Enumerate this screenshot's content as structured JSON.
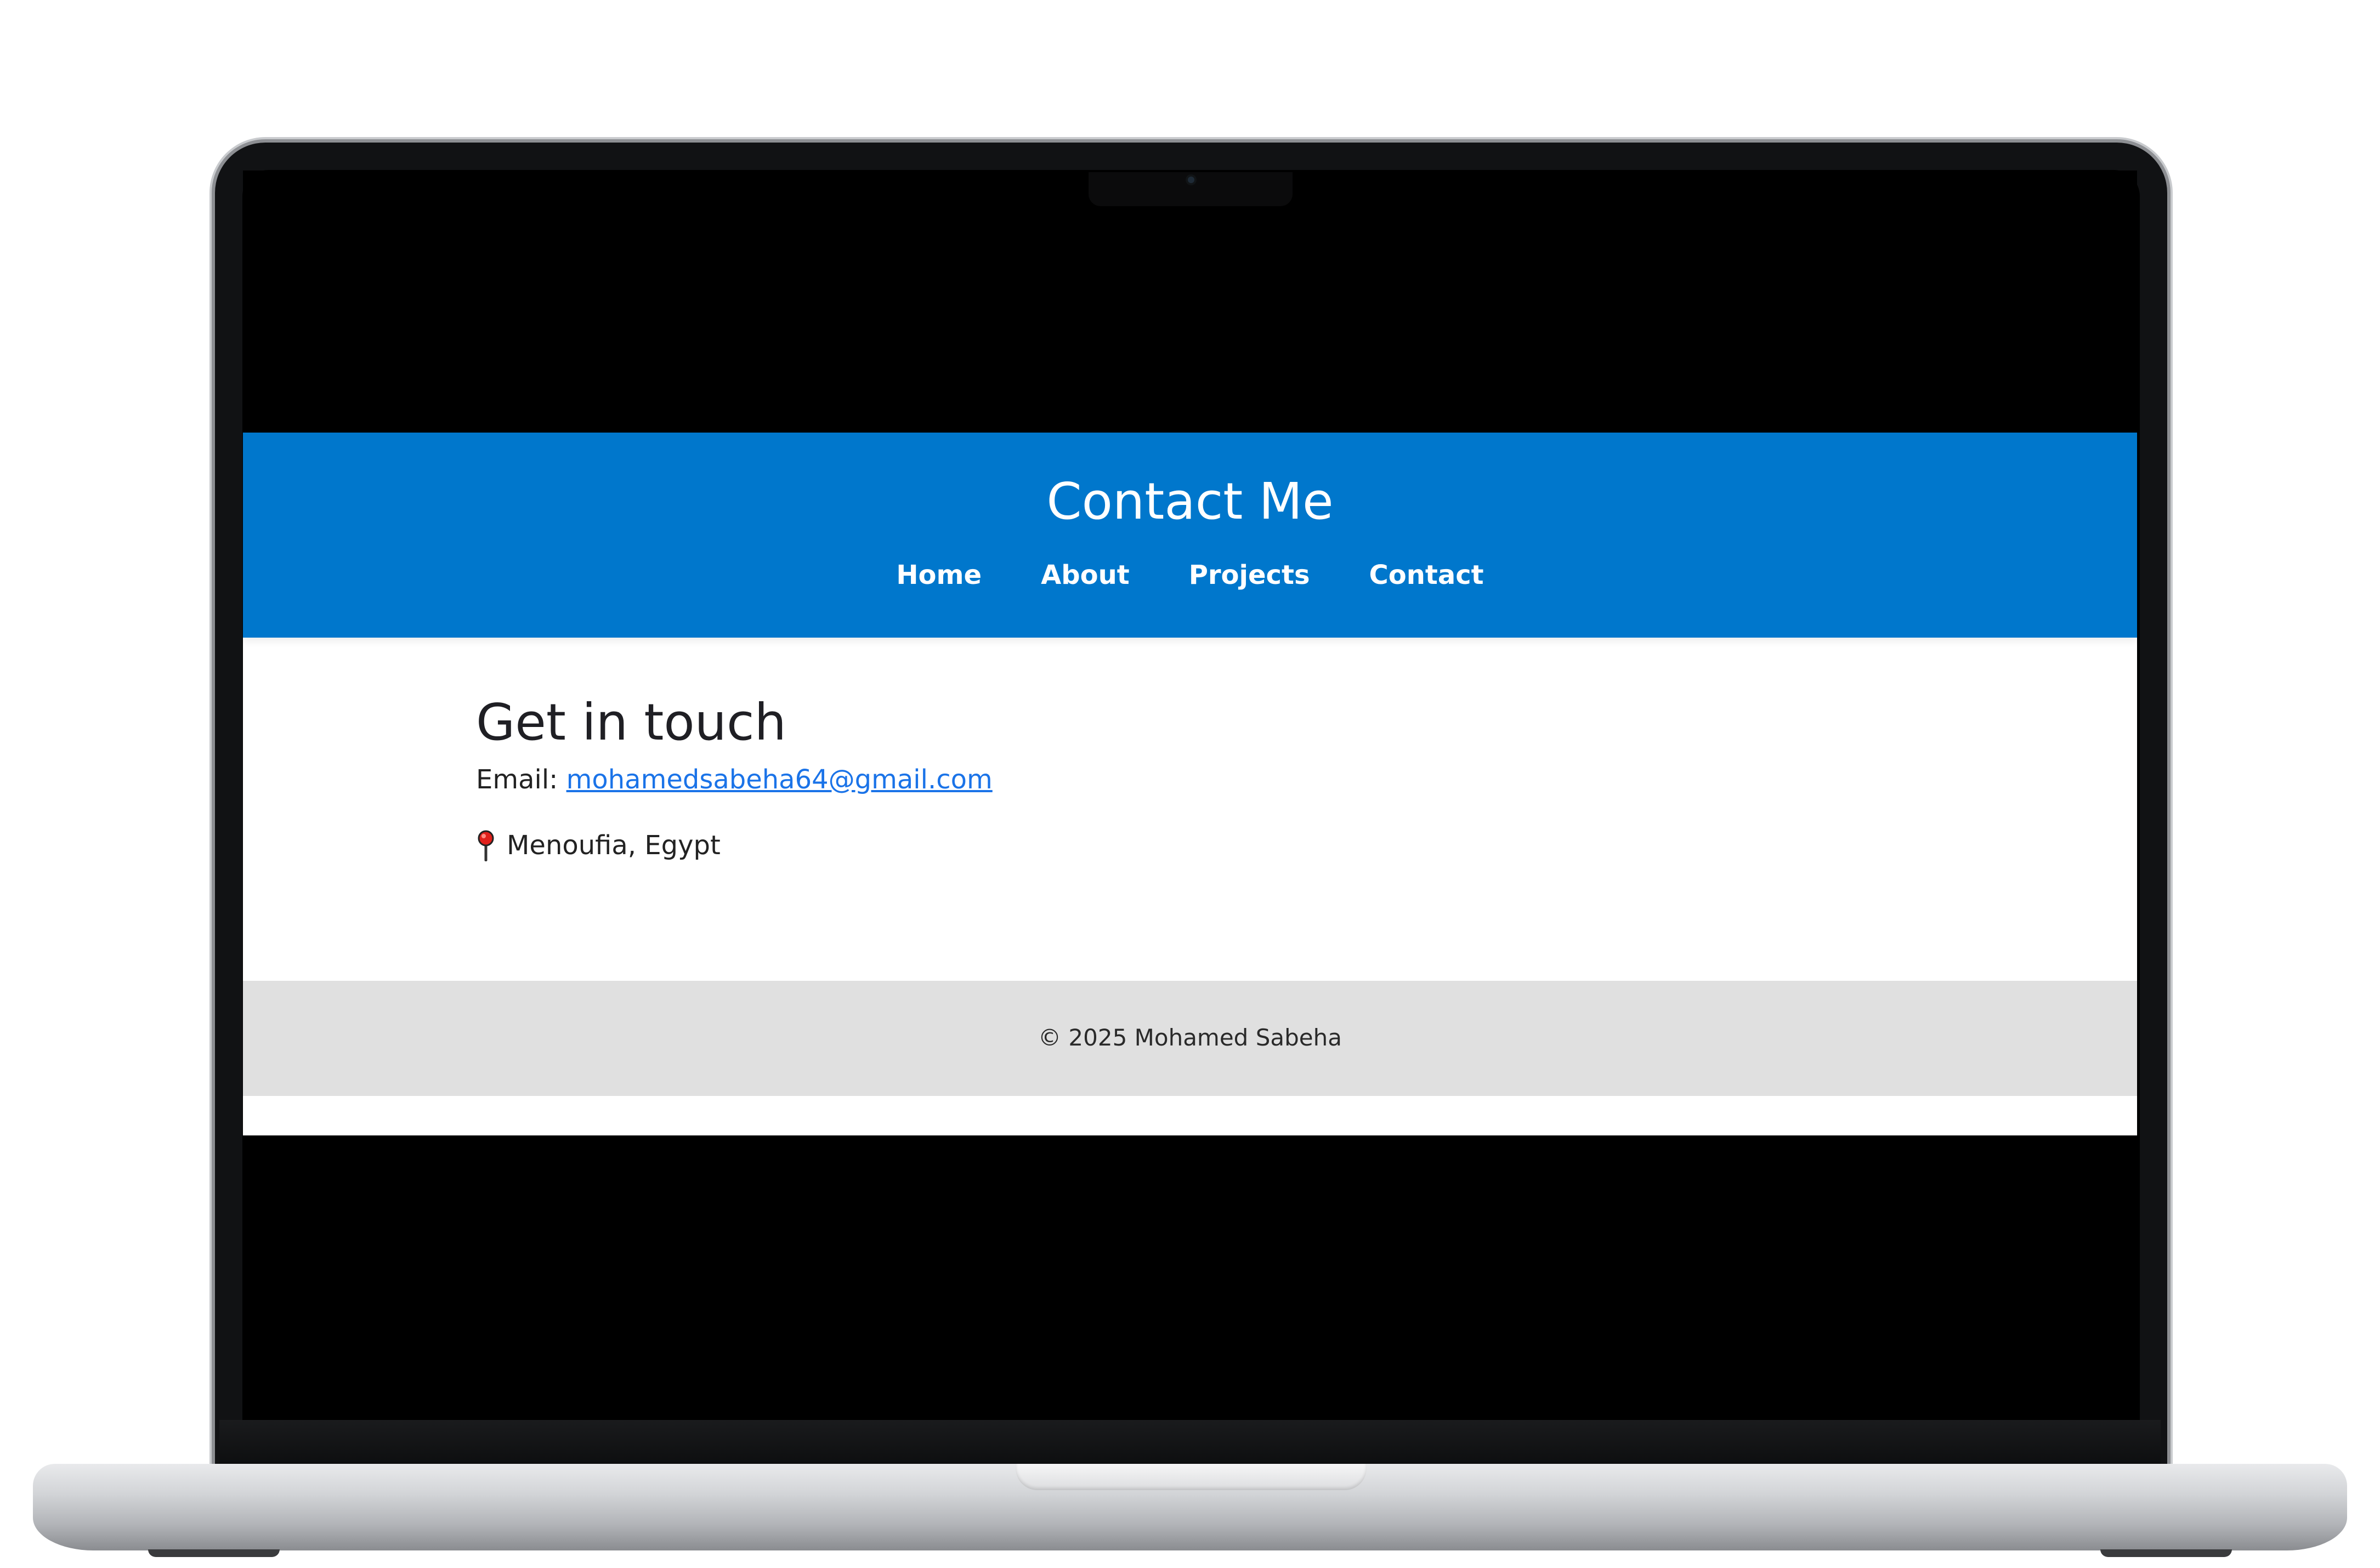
{
  "header": {
    "title": "Contact Me",
    "nav": [
      {
        "label": "Home"
      },
      {
        "label": "About"
      },
      {
        "label": "Projects"
      },
      {
        "label": "Contact"
      }
    ]
  },
  "main": {
    "heading": "Get in touch",
    "email_label": "Email: ",
    "email_value": "mohamedsabeha64@gmail.com",
    "location_icon": "round-pushpin-icon",
    "location_text": "Menoufia, Egypt"
  },
  "footer": {
    "copyright": "© 2025 Mohamed Sabeha"
  },
  "colors": {
    "header_bg": "#0077cc",
    "link": "#1a73e8",
    "footer_bg": "#e0e0e0"
  }
}
